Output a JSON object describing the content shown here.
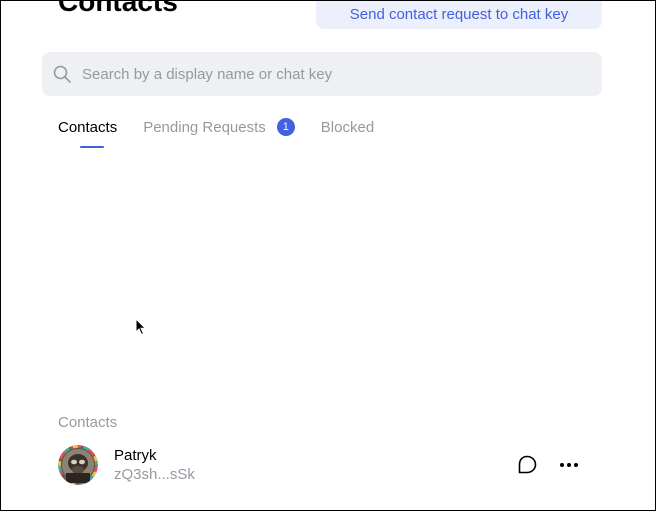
{
  "header": {
    "title": "Contacts",
    "send_request_label": "Send contact request to chat key"
  },
  "search": {
    "placeholder": "Search by a display name or chat key",
    "value": ""
  },
  "tabs": [
    {
      "label": "Contacts",
      "active": true
    },
    {
      "label": "Pending Requests",
      "active": false,
      "badge": "1"
    },
    {
      "label": "Blocked",
      "active": false
    }
  ],
  "contacts_section": {
    "label": "Contacts",
    "items": [
      {
        "name": "Patryk",
        "chat_key": "zQ3sh...sSk",
        "avatar": "avatar-image"
      }
    ]
  },
  "colors": {
    "accent": "#4360df",
    "accent_bg": "#eceffc",
    "muted_text": "#939ba1",
    "search_bg": "#eef0f3"
  },
  "icons": {
    "search": "search-icon",
    "chat": "chat-icon",
    "more": "more-icon",
    "cursor": "mouse-cursor-icon"
  }
}
